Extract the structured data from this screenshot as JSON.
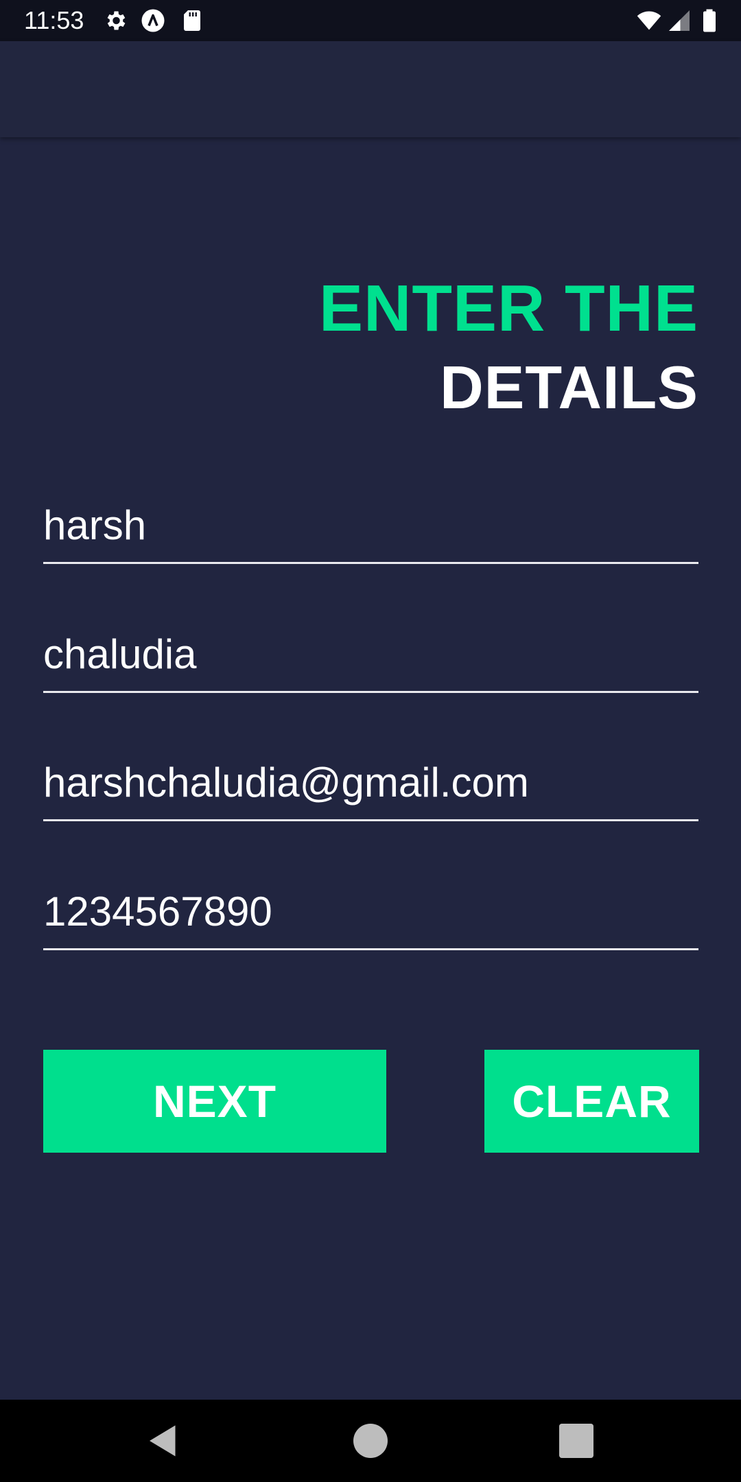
{
  "status_bar": {
    "time": "11:53",
    "left_icons": [
      "gear-icon",
      "app-notification-icon",
      "sd-card-icon"
    ],
    "right_icons": [
      "wifi-icon",
      "signal-icon",
      "battery-icon"
    ]
  },
  "title": {
    "line1": "ENTER THE",
    "line2": "DETAILS",
    "line1_color": "#00e08f",
    "line2_color": "#ffffff"
  },
  "form": {
    "first_name": {
      "value": "harsh"
    },
    "last_name": {
      "value": "chaludia"
    },
    "email": {
      "value": "harshchaludia@gmail.com"
    },
    "phone": {
      "value": "1234567890"
    }
  },
  "buttons": {
    "next_label": "NEXT",
    "clear_label": "CLEAR",
    "accent_color": "#00df8d"
  },
  "nav": {
    "icons": [
      "back-icon",
      "home-icon",
      "recents-icon"
    ]
  },
  "colors": {
    "background": "#212540",
    "status_bar": "#0f111d",
    "nav_bar": "#000000"
  }
}
